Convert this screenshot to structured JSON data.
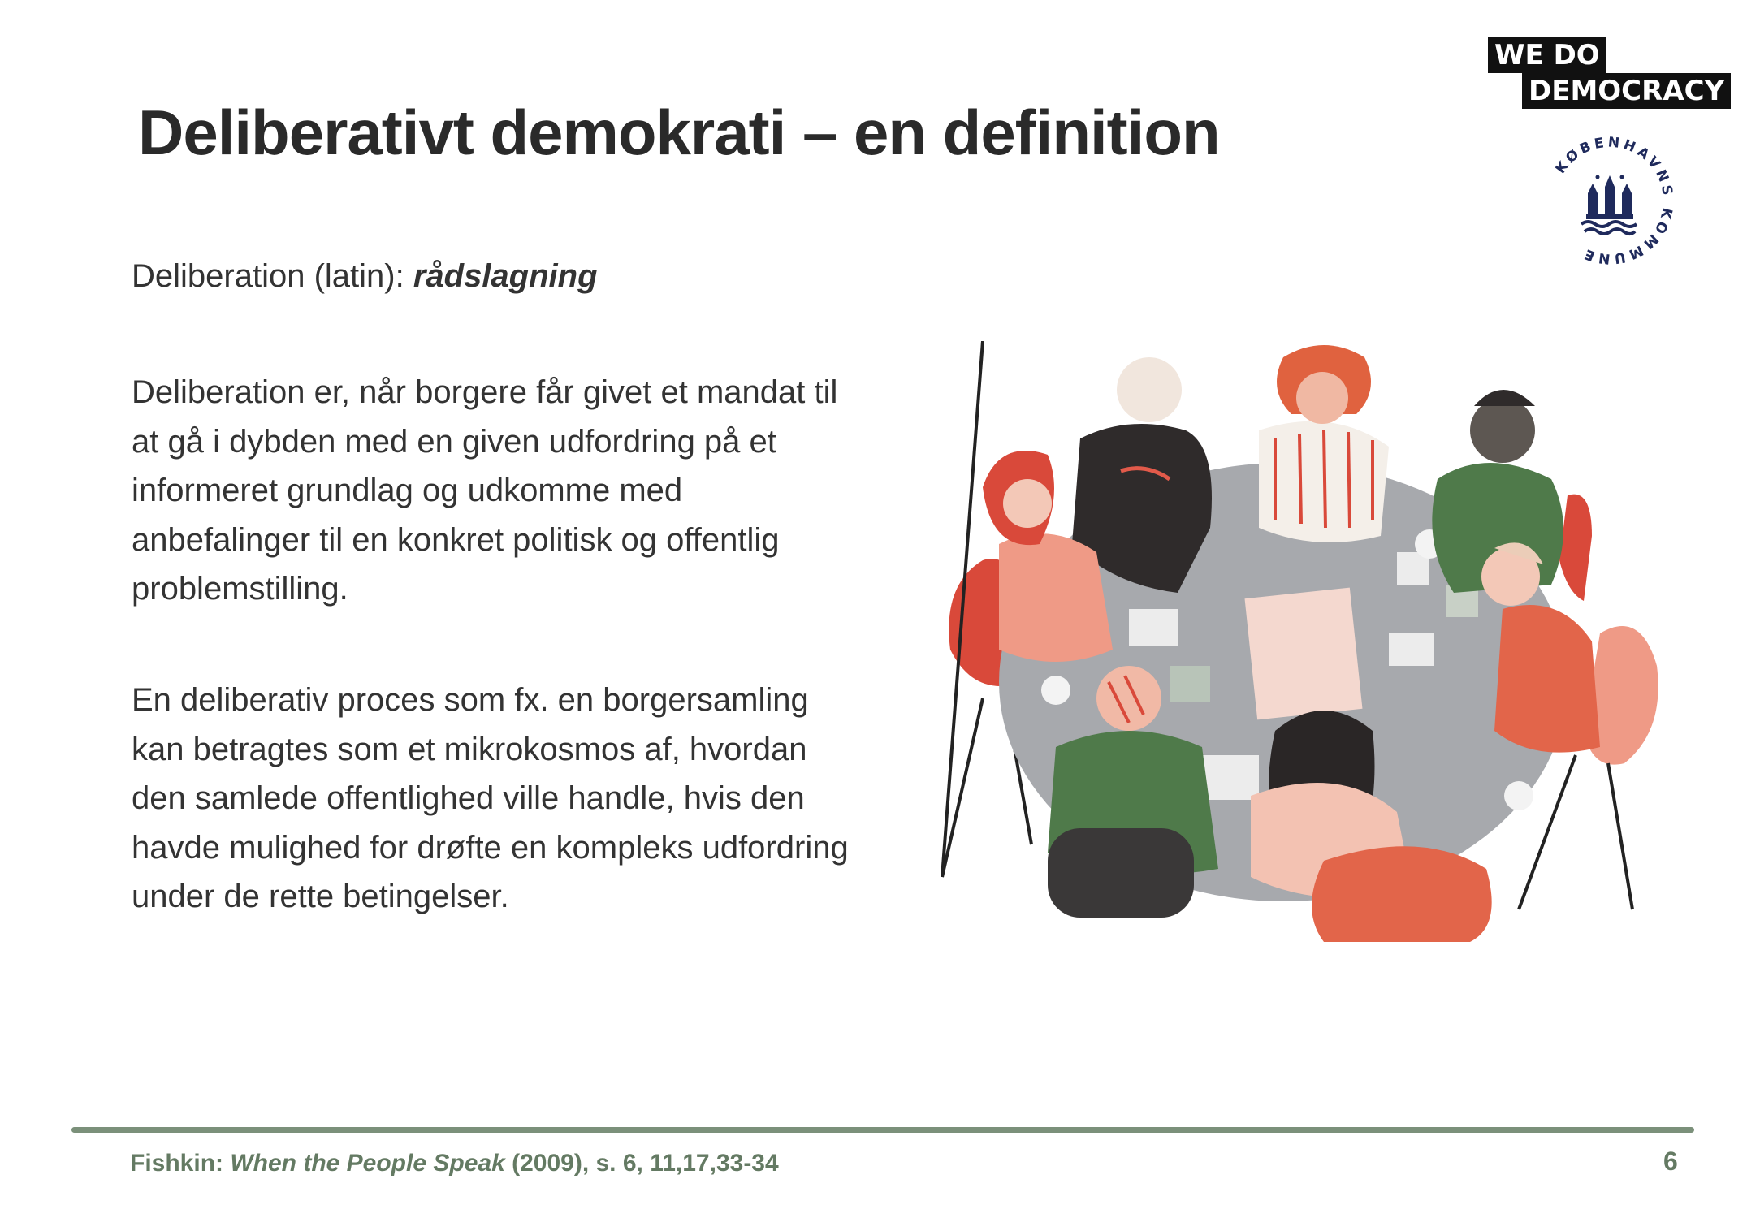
{
  "slide": {
    "title": "Deliberativt demokrati – en definition",
    "page_number": "6"
  },
  "logos": {
    "wedodemocracy_line1": "WE  DO",
    "wedodemocracy_line2": "DEMOCRACY",
    "kommune_text": "KØBENHAVNS KOMMUNE"
  },
  "definition": {
    "prefix": "Deliberation (latin): ",
    "term": "rådslagning"
  },
  "paragraphs": [
    "Deliberation er, når borgere får givet et mandat til at gå i dybden med en given udfordring på et informeret grundlag og udkomme med anbefalinger til en konkret politisk og offentlig problemstilling.",
    "En deliberativ proces som fx. en borgersamling kan betragtes som et mikrokosmos af, hvordan den samlede offentlighed ville handle, hvis den havde mulighed for drøfte en kompleks udfordring under de rette betingelser."
  ],
  "citation": {
    "author": "Fishkin: ",
    "work": "When the People Speak",
    "rest": " (2009), s. 6, 11,17,33-34"
  },
  "colors": {
    "accent_green": "#647a63",
    "rule_green": "#7b907a",
    "kbh_blue": "#1f2a5c"
  }
}
